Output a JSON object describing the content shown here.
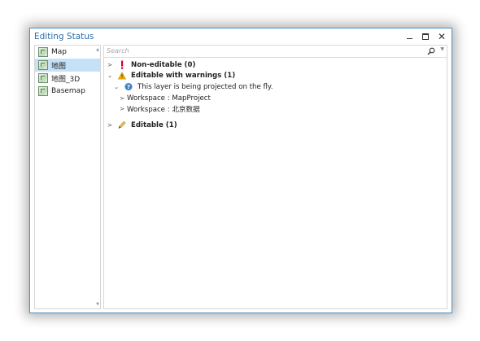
{
  "window": {
    "title": "Editing Status",
    "minimize": "–",
    "maximize": "□",
    "close": "✕"
  },
  "maps": [
    {
      "name": "Map"
    },
    {
      "name": "地图"
    },
    {
      "name": "地图_3D"
    },
    {
      "name": "Basemap"
    }
  ],
  "selected_map_index": 1,
  "search": {
    "placeholder": "Search"
  },
  "tree": {
    "non_editable": {
      "label": "Non-editable (0)"
    },
    "warnings": {
      "label": "Editable with warnings (1)",
      "message": "This layer is being projected on the fly.",
      "workspaces": [
        "Workspace : MapProject",
        "Workspace : 北京数据"
      ]
    },
    "editable": {
      "label": "Editable (1)"
    }
  },
  "colors": {
    "accent": "#2a6ea8",
    "selection": "#c5e1f7",
    "error": "#d0021b",
    "warning": "#f5b400",
    "info": "#3b82c4"
  }
}
